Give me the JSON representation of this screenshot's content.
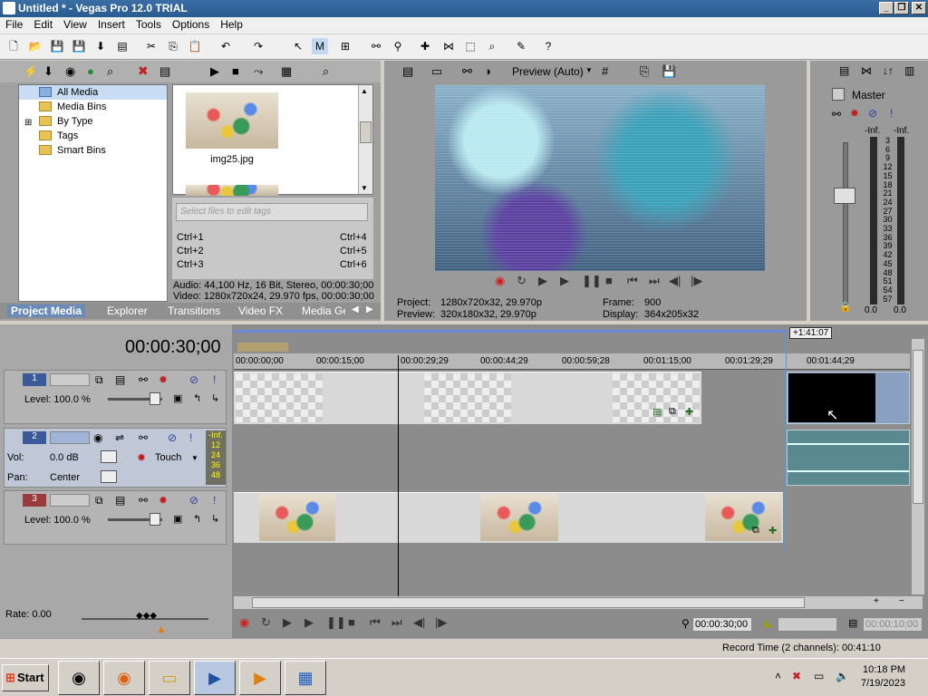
{
  "window": {
    "title": "Untitled * - Vegas Pro 12.0 TRIAL"
  },
  "menu": [
    "File",
    "Edit",
    "View",
    "Insert",
    "Tools",
    "Options",
    "Help"
  ],
  "media": {
    "tree": [
      "All Media",
      "Media Bins",
      "By Type",
      "Tags",
      "Smart Bins"
    ],
    "thumb_label": "img25.jpg",
    "tag_placeholder": "Select files to edit tags",
    "shortcuts": [
      [
        "Ctrl+1",
        "Ctrl+4"
      ],
      [
        "Ctrl+2",
        "Ctrl+5"
      ],
      [
        "Ctrl+3",
        "Ctrl+6"
      ]
    ],
    "audio_info": "Audio: 44,100 Hz, 16 Bit, Stereo, 00:00:30;00",
    "video_info": "Video: 1280x720x24, 29.970 fps, 00:00:30;00",
    "tabs": [
      "Project Media",
      "Explorer",
      "Transitions",
      "Video FX",
      "Media Gen"
    ]
  },
  "preview": {
    "mode": "Preview (Auto)",
    "project_label": "Project:",
    "project_value": "1280x720x32, 29.970p",
    "preview_label": "Preview:",
    "preview_value": "320x180x32, 29.970p",
    "frame_label": "Frame:",
    "frame_value": "900",
    "display_label": "Display:",
    "display_value": "364x205x32"
  },
  "master": {
    "title": "Master",
    "inf_left": "-Inf.",
    "inf_right": "-Inf.",
    "scale": [
      "3",
      "6",
      "9",
      "12",
      "15",
      "18",
      "21",
      "24",
      "27",
      "30",
      "33",
      "36",
      "39",
      "42",
      "45",
      "48",
      "51",
      "54",
      "57"
    ],
    "bottom_left": "0.0",
    "bottom_right": "0.0"
  },
  "timeline": {
    "current_time": "00:00:30;00",
    "end_marker": "+1:41:07",
    "ruler": [
      "00:00:00;00",
      "00:00:15;00",
      "00:00:29;29",
      "00:00:44;29",
      "00:00:59;28",
      "00:01:15;00",
      "00:01:29;29",
      "00:01:44;29"
    ],
    "tracks": [
      {
        "num": "1",
        "level": "Level: 100.0 %"
      },
      {
        "num": "2",
        "vol_label": "Vol:",
        "vol": "0.0 dB",
        "pan_label": "Pan:",
        "pan": "Center",
        "mode": "Touch",
        "meter": [
          "-Inf.",
          "12",
          "24",
          "36",
          "48"
        ]
      },
      {
        "num": "3",
        "level": "Level: 100.0 %"
      }
    ],
    "rate": "Rate: 0.00",
    "cursor_time": "00:00:30;00",
    "sel_time": "00:00:10;00",
    "record_time": "Record Time (2 channels): 00:41:10"
  },
  "taskbar": {
    "start": "Start",
    "time": "10:18 PM",
    "date": "7/19/2023"
  }
}
